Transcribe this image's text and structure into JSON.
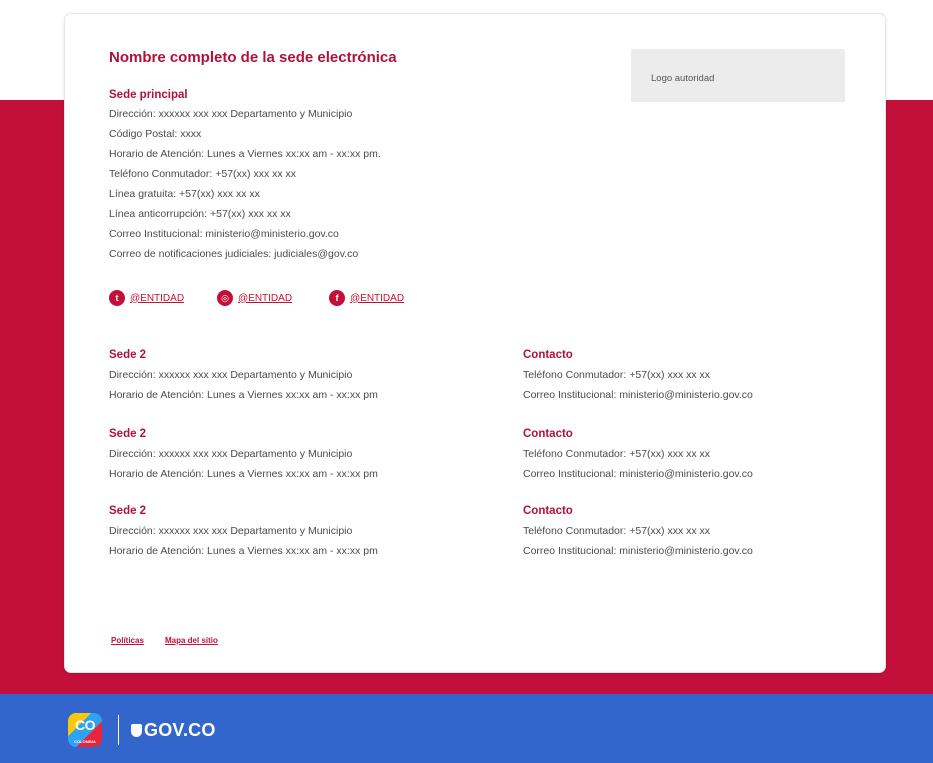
{
  "header": {
    "title": "Nombre completo de la sede electrónica",
    "logo_text": "Logo autoridad"
  },
  "main_office": {
    "title": "Sede principal",
    "lines": [
      "Dirección: xxxxxx xxx xxx Departamento y Municipio",
      "Código Postal: xxxx",
      "Horario de Atención: Lunes a Viernes xx:xx am - xx:xx pm.",
      "Teléfono Conmutador: +57(xx) xxx xx xx",
      "Línea gratuita: +57(xx) xxx xx xx",
      "Línea anticorrupción: +57(xx) xxx xx xx",
      "Correo Institucional: ministerio@ministerio.gov.co",
      "Correo de notificaciones judiciales: judiciales@gov.co"
    ]
  },
  "social": [
    {
      "icon": "twitter-icon",
      "glyph": "t",
      "label": "@ENTIDAD"
    },
    {
      "icon": "instagram-icon",
      "glyph": "◎",
      "label": "@ENTIDAD"
    },
    {
      "icon": "facebook-icon",
      "glyph": "f",
      "label": "@ENTIDAD"
    }
  ],
  "branches": [
    {
      "title": "Sede 2",
      "address": "Dirección: xxxxxx xxx xxx Departamento y Municipio",
      "hours": "Horario de Atención: Lunes a Viernes xx:xx am - xx:xx pm",
      "contact_title": "Contacto",
      "phone": "Teléfono Conmutador: +57(xx) xxx xx xx",
      "email": "Correo Institucional: ministerio@ministerio.gov.co"
    },
    {
      "title": "Sede 2",
      "address": "Dirección: xxxxxx xxx xxx Departamento y Municipio",
      "hours": "Horario de Atención: Lunes a Viernes xx:xx am - xx:xx pm",
      "contact_title": "Contacto",
      "phone": "Teléfono Conmutador: +57(xx) xxx xx xx",
      "email": "Correo Institucional: ministerio@ministerio.gov.co"
    },
    {
      "title": "Sede 2",
      "address": "Dirección: xxxxxx xxx xxx Departamento y Municipio",
      "hours": "Horario de Atención: Lunes a Viernes xx:xx am - xx:xx pm",
      "contact_title": "Contacto",
      "phone": "Teléfono Conmutador: +57(xx) xxx xx xx",
      "email": "Correo Institucional: ministerio@ministerio.gov.co"
    }
  ],
  "footer_links": {
    "policies": "Políticas",
    "sitemap": "Mapa del sitio"
  },
  "brand_bar": {
    "co_logo_text": "CO",
    "co_logo_sub": "COLOMBIA",
    "govco_text": "GOV.CO"
  },
  "colors": {
    "accent_red": "#c2103a",
    "gov_blue": "#3366cc"
  }
}
